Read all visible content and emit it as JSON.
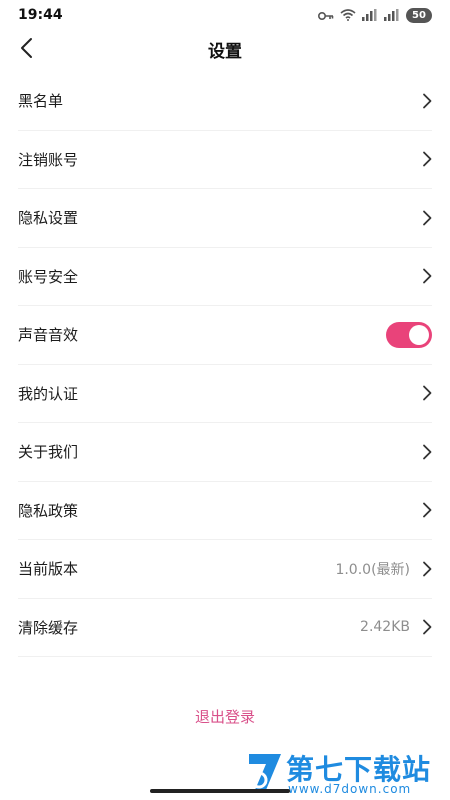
{
  "status_bar": {
    "time": "19:44",
    "battery": "50",
    "icons": [
      "key-icon",
      "wifi-icon",
      "signal-icon",
      "signal-icon"
    ]
  },
  "nav": {
    "title": "设置",
    "back_icon": "chevron-left-icon"
  },
  "items": [
    {
      "label": "黑名单",
      "type": "link"
    },
    {
      "label": "注销账号",
      "type": "link"
    },
    {
      "label": "隐私设置",
      "type": "link"
    },
    {
      "label": "账号安全",
      "type": "link"
    },
    {
      "label": "声音音效",
      "type": "toggle",
      "on": true
    },
    {
      "label": "我的认证",
      "type": "link"
    },
    {
      "label": "关于我们",
      "type": "link"
    },
    {
      "label": "隐私政策",
      "type": "link"
    },
    {
      "label": "当前版本",
      "type": "link",
      "value": "1.0.0(最新)"
    },
    {
      "label": "清除缓存",
      "type": "link",
      "value": "2.42KB"
    }
  ],
  "logout_label": "退出登录",
  "watermark": {
    "title": "第七下载站",
    "url": "www.d7down.com"
  },
  "colors": {
    "accent": "#e9437a",
    "logout": "#d9508a",
    "watermark": "#1f8be0"
  }
}
